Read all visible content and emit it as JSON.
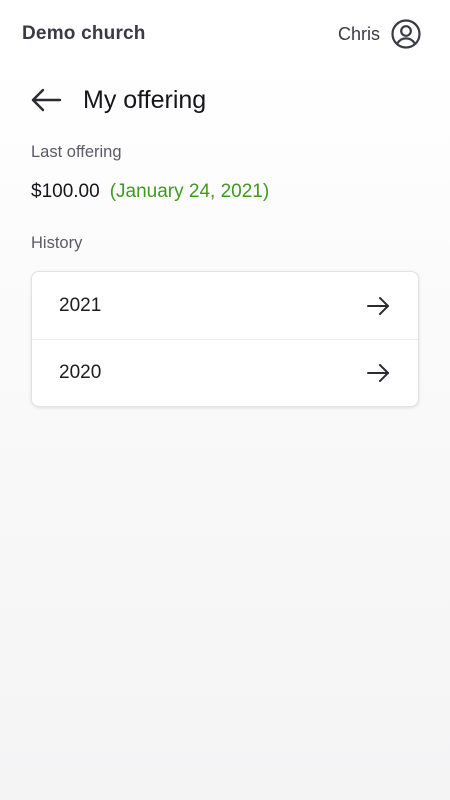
{
  "header": {
    "church_name": "Demo church",
    "user_name": "Chris",
    "avatar_icon": "user-circle-icon"
  },
  "page": {
    "title": "My offering",
    "back_icon": "arrow-left-icon"
  },
  "last_offering": {
    "label": "Last offering",
    "amount": "$100.00",
    "date": "(January 24, 2021)"
  },
  "history": {
    "label": "History",
    "items": [
      {
        "year": "2021",
        "icon": "arrow-right-icon"
      },
      {
        "year": "2020",
        "icon": "arrow-right-icon"
      }
    ]
  },
  "colors": {
    "date_green": "#3f9a1f",
    "text_primary": "#15151b",
    "text_secondary": "#5b5b66"
  }
}
